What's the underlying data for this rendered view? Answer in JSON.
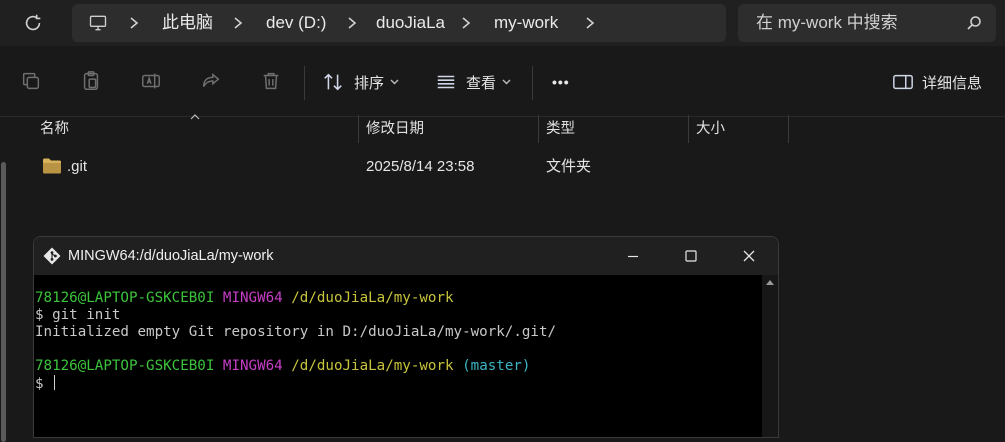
{
  "address": {
    "crumbs": [
      "此电脑",
      "dev (D:)",
      "duoJiaLa",
      "my-work"
    ]
  },
  "search": {
    "placeholder": "在 my-work 中搜索"
  },
  "toolbar": {
    "sort_label": "排序",
    "view_label": "查看",
    "more_label": "•••",
    "details_label": "详细信息"
  },
  "columns": {
    "name": "名称",
    "modified": "修改日期",
    "type": "类型",
    "size": "大小"
  },
  "files": [
    {
      "name": ".git",
      "modified": "2025/8/14 23:58",
      "type": "文件夹",
      "size": ""
    }
  ],
  "terminal": {
    "title": "MINGW64:/d/duoJiaLa/my-work",
    "user_host": "78126@LAPTOP-GSKCEB0I",
    "env": "MINGW64",
    "path": "/d/duoJiaLa/my-work",
    "command": "$ git init",
    "output": "Initialized empty Git repository in D:/duoJiaLa/my-work/.git/",
    "branch": "(master)",
    "prompt": "$ "
  },
  "colors": {
    "user": "#3cc43c",
    "env": "#c73ec7",
    "path": "#c7c43c",
    "branch": "#3cb6c4",
    "folder": "#d8b25a"
  }
}
